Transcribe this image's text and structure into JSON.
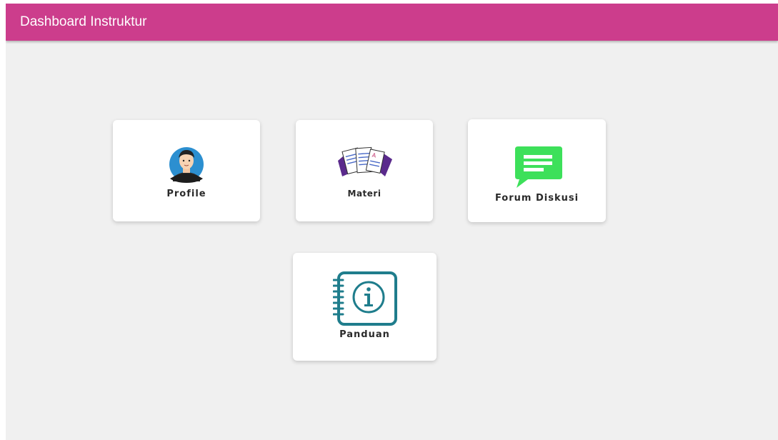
{
  "header": {
    "title": "Dashboard Instruktur",
    "color": "#cc3d8c"
  },
  "menu": {
    "profile": {
      "label": "Profile",
      "icon": "user-avatar-icon"
    },
    "materi": {
      "label": "Materi",
      "icon": "documents-icon"
    },
    "forum": {
      "label": "Forum Diskusi",
      "icon": "chat-icon",
      "icon_color": "#3de05a"
    },
    "panduan": {
      "label": "Panduan",
      "icon": "info-notebook-icon",
      "icon_color": "#1f7d8c"
    }
  }
}
